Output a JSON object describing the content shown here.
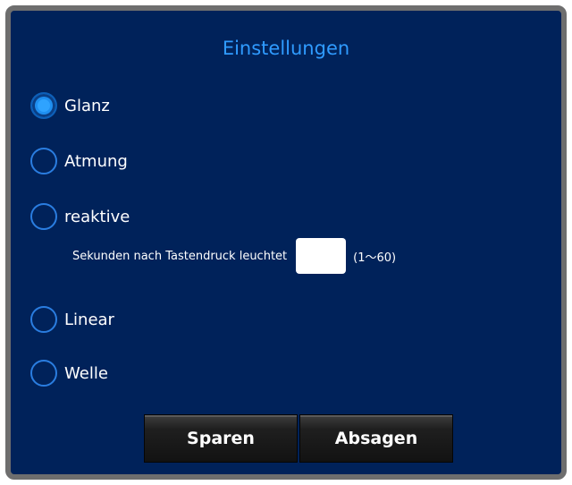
{
  "dialog": {
    "title": "Einstellungen"
  },
  "options": [
    {
      "label": "Glanz",
      "checked": true
    },
    {
      "label": "Atmung",
      "checked": false
    },
    {
      "label": "reaktive",
      "checked": false
    },
    {
      "label": "Linear",
      "checked": false
    },
    {
      "label": "Welle",
      "checked": false
    }
  ],
  "reactive_setting": {
    "label": "Sekunden nach Tastendruck leuchtet",
    "value": "",
    "range": "(1〜60)"
  },
  "buttons": {
    "save": "Sparen",
    "cancel": "Absagen"
  },
  "colors": {
    "background": "#00225a",
    "title": "#2f9bff",
    "radio_accent": "#1f8ff0",
    "frame": "#6e6e6e"
  },
  "icons": {
    "radio_checked": "radio-checked-icon",
    "radio_unchecked": "radio-unchecked-icon"
  }
}
